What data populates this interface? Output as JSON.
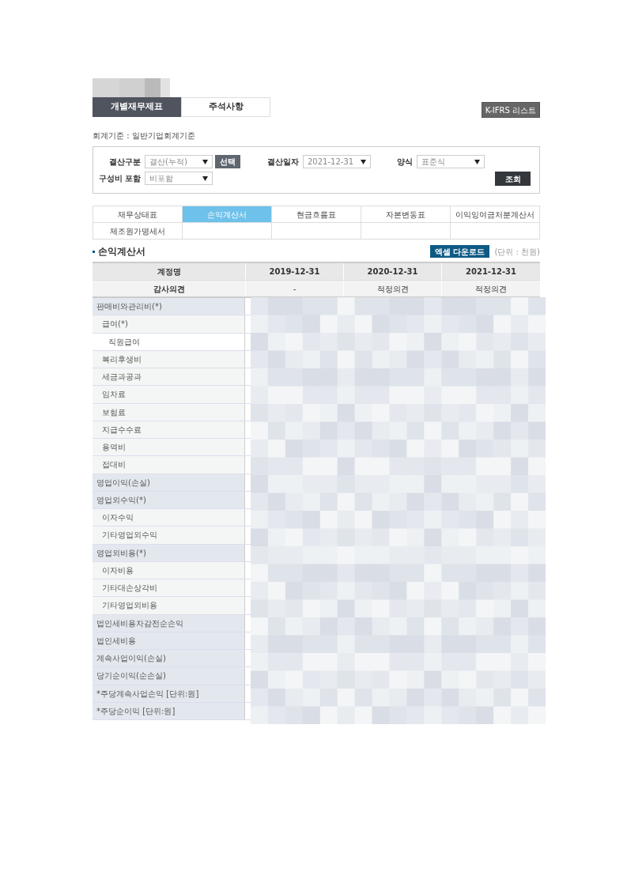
{
  "top_tabs": [
    {
      "label": "개별재무제표",
      "selected": true
    },
    {
      "label": "주석사항",
      "selected": false
    }
  ],
  "kifrs_button": "K-IFRS 리스트",
  "accounting_standard": "회계기준 : 일반기업회계기준",
  "filters": {
    "settlement_type": {
      "label": "결산구분",
      "value": "결산(누적)"
    },
    "select_button": "선택",
    "settlement_date": {
      "label": "결산일자",
      "value": "2021-12-31"
    },
    "format": {
      "label": "양식",
      "value": "표준식"
    },
    "include_cost": {
      "label": "구성비 포함",
      "value": "비포함"
    },
    "search_button": "조회"
  },
  "statement_tabs": [
    {
      "label": "재무상태표",
      "selected": false
    },
    {
      "label": "손익계산서",
      "selected": true
    },
    {
      "label": "현금흐름표",
      "selected": false
    },
    {
      "label": "자본변동표",
      "selected": false
    },
    {
      "label": "이익잉여금처분계산서",
      "selected": false
    },
    {
      "label": "제조원가명세서",
      "selected": false
    }
  ],
  "section_title": "손익계산서",
  "excel_button": "엑셀 다운로드",
  "unit_note": "(단위 : 천원)",
  "table": {
    "columns": [
      "계정명",
      "2019-12-31",
      "2020-12-31",
      "2021-12-31"
    ],
    "audit_row": [
      "감사의견",
      "-",
      "적정의견",
      "적정의견"
    ],
    "rows": [
      {
        "name": "판매비와관리비(*)",
        "children": [
          {
            "name": "급여(*)",
            "children": [
              {
                "name": "직원급여"
              }
            ]
          },
          {
            "name": "복리후생비"
          },
          {
            "name": "세금과공과"
          },
          {
            "name": "임차료"
          },
          {
            "name": "보험료"
          },
          {
            "name": "지급수수료"
          },
          {
            "name": "용역비"
          },
          {
            "name": "접대비"
          }
        ]
      },
      {
        "name": "영업이익(손실)"
      },
      {
        "name": "영업외수익(*)",
        "children": [
          {
            "name": "이자수익"
          },
          {
            "name": "기타영업외수익"
          }
        ]
      },
      {
        "name": "영업외비용(*)",
        "children": [
          {
            "name": "이자비용"
          },
          {
            "name": "기타대손상각비"
          },
          {
            "name": "기타영업외비용"
          }
        ]
      },
      {
        "name": "법인세비용차감전순손익"
      },
      {
        "name": "법인세비용"
      },
      {
        "name": "계속사업이익(손실)"
      },
      {
        "name": "당기순이익(순손실)"
      },
      {
        "name": "*주당계속사업손익 [단위:원]"
      },
      {
        "name": "*주당순이익 [단위:원]"
      }
    ]
  }
}
